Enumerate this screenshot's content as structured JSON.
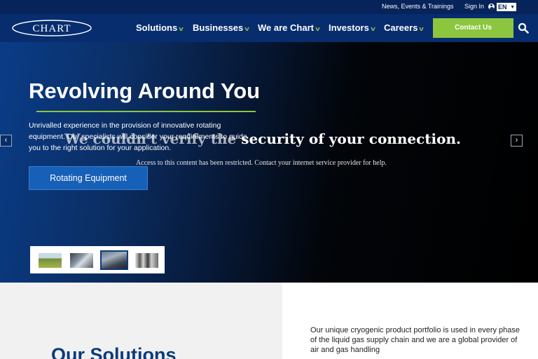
{
  "utility": {
    "news_label": "News, Events & Trainings",
    "signin_label": "Sign In",
    "user_icon": "user-circle-icon",
    "language": "EN",
    "chevron_icon": "chevron-down-icon"
  },
  "header": {
    "logo_text": "CHART",
    "nav": [
      {
        "label": "Solutions"
      },
      {
        "label": "Businesses"
      },
      {
        "label": "We are Chart"
      },
      {
        "label": "Investors"
      },
      {
        "label": "Careers"
      }
    ],
    "contact_label": "Contact Us",
    "search_icon": "search-icon"
  },
  "hero": {
    "title": "Revolving Around You",
    "description": "Unrivalled experience in the provision of innovative rotating equipment. Our specialists will consider your requirements to guide you to the right solution for your application.",
    "cta_label": "Rotating Equipment",
    "overlay_heading_lead": "We couldn't verify the",
    "overlay_heading_rest": " security of your connection.",
    "overlay_subtext": "Access to this content has been restricted. Contact your internet service provider for help.",
    "prev_label": "‹",
    "next_label": "›"
  },
  "main": {
    "solutions_title": "Our Solutions",
    "intro": "Our unique cryogenic product portfolio is used in every phase of the liquid gas supply chain and we are a global provider of air and gas handling"
  },
  "colors": {
    "utility_bg": "#06245a",
    "nav_bg": "#072d6e",
    "accent_green": "#8cc63f",
    "cta_blue": "#1660b8",
    "heading_blue": "#0b3b7c"
  }
}
